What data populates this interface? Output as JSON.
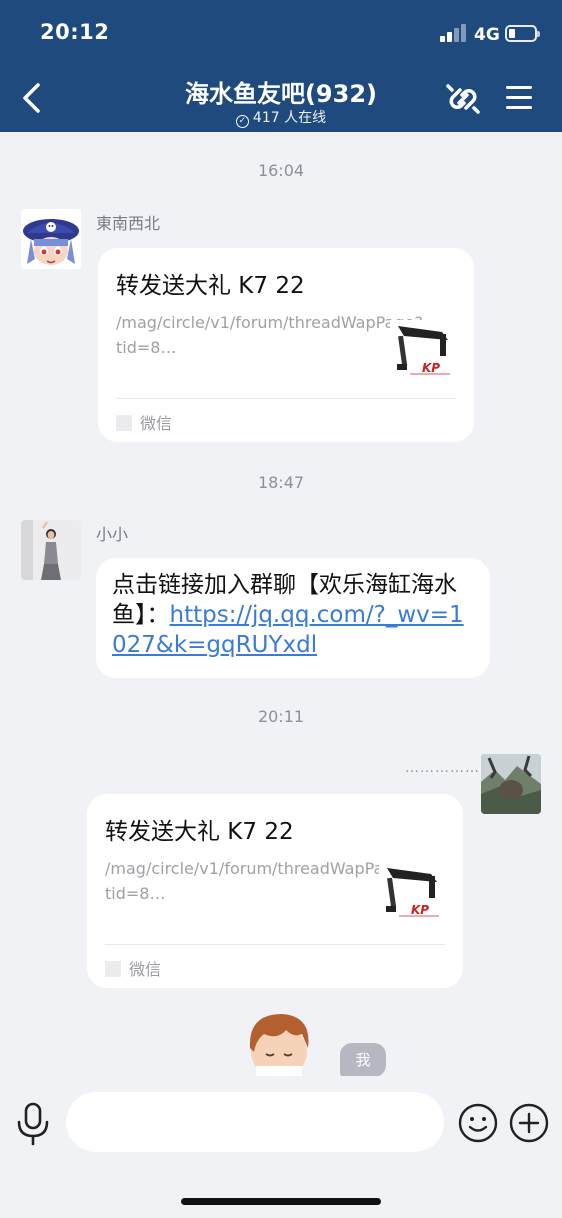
{
  "status_bar": {
    "time": "20:12",
    "network": "4G"
  },
  "nav": {
    "title": "海水鱼友吧(932)",
    "online_icon": "check-circle-icon",
    "online_text": "417 人在线",
    "back_icon": "chevron-left-icon",
    "link_icon": "link-icon",
    "menu_icon": "hamburger-menu-icon"
  },
  "messages": [
    {
      "time": "16:04",
      "sender": "東南西北",
      "avatar": "pirate-cartoon-avatar",
      "type": "card",
      "card": {
        "title": "转发送大礼 K7 22",
        "desc": "/mag/circle/v1/forum/threadWapPage?tid=8…",
        "source": "微信",
        "thumb": "aquarium-light-thumbnail"
      }
    },
    {
      "time": "18:47",
      "sender": "小小",
      "avatar": "woman-photo-avatar",
      "type": "text",
      "text": "点击链接加入群聊【欢乐海缸海水鱼】：",
      "link": "https://jq.qq.com/?_wv=1027&k=gqRUYxdl"
    },
    {
      "time": "20:11",
      "sender": "",
      "avatar": "landscape-photo-avatar",
      "type": "card",
      "status": "……………",
      "card": {
        "title": "转发送大礼 K7 22",
        "desc": "/mag/circle/v1/forum/threadWapPage?tid=8…",
        "source": "微信",
        "thumb": "aquarium-light-thumbnail"
      }
    }
  ],
  "me_tag": "我",
  "composer": {
    "placeholder": "",
    "mic_icon": "microphone-icon",
    "emoji_icon": "smiley-icon",
    "plus_icon": "plus-circle-icon"
  },
  "colors": {
    "header": "#1e4a7e",
    "background": "#f1f2f6",
    "link": "#3a7bd5"
  }
}
